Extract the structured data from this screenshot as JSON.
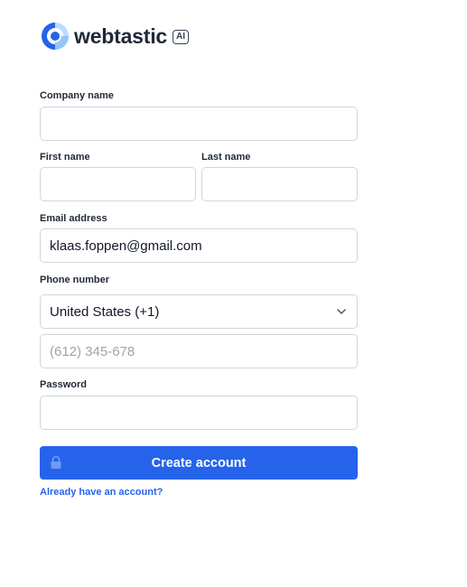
{
  "brand": {
    "name": "webtastic",
    "badge": "AI"
  },
  "form": {
    "company_name": {
      "label": "Company name",
      "value": ""
    },
    "first_name": {
      "label": "First name",
      "value": ""
    },
    "last_name": {
      "label": "Last name",
      "value": ""
    },
    "email": {
      "label": "Email address",
      "value": "klaas.foppen@gmail.com"
    },
    "phone": {
      "label": "Phone number",
      "country_selected": "United States (+1)",
      "placeholder": "(612) 345-678"
    },
    "password": {
      "label": "Password",
      "value": ""
    },
    "submit_label": "Create account",
    "signin_link": "Already have an account?"
  },
  "icons": {
    "logo": "webtastic-logo-icon",
    "lock": "lock-icon",
    "chevron": "chevron-down-icon"
  },
  "colors": {
    "accent": "#2563eb",
    "logo_blue": "#2563eb",
    "logo_light": "#93c5fd"
  }
}
